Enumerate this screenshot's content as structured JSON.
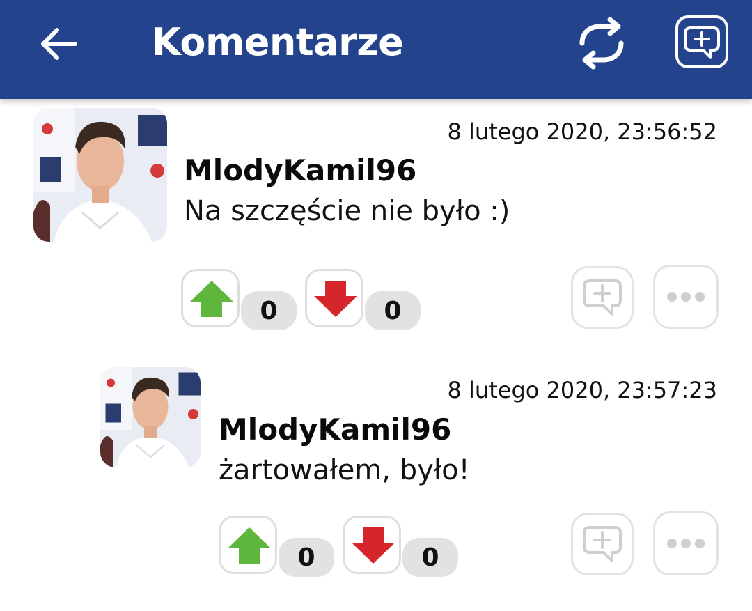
{
  "appbar": {
    "title": "Komentarze",
    "icons": {
      "back": "back-arrow-icon",
      "refresh": "refresh-icon",
      "new_comment": "add-comment-icon"
    },
    "color": "#23448c"
  },
  "comments": [
    {
      "timestamp": "8 lutego 2020, 23:56:52",
      "author": "MlodyKamil96",
      "text": "Na szczęście nie było :)",
      "upvotes": "0",
      "downvotes": "0"
    },
    {
      "timestamp": "8 lutego 2020, 23:57:23",
      "author": "MlodyKamil96",
      "text": "żartowałem, było!",
      "upvotes": "0",
      "downvotes": "0"
    }
  ],
  "colors": {
    "upvote": "#5fb63c",
    "downvote": "#d5262b",
    "count_bg": "#e2e2e2"
  }
}
